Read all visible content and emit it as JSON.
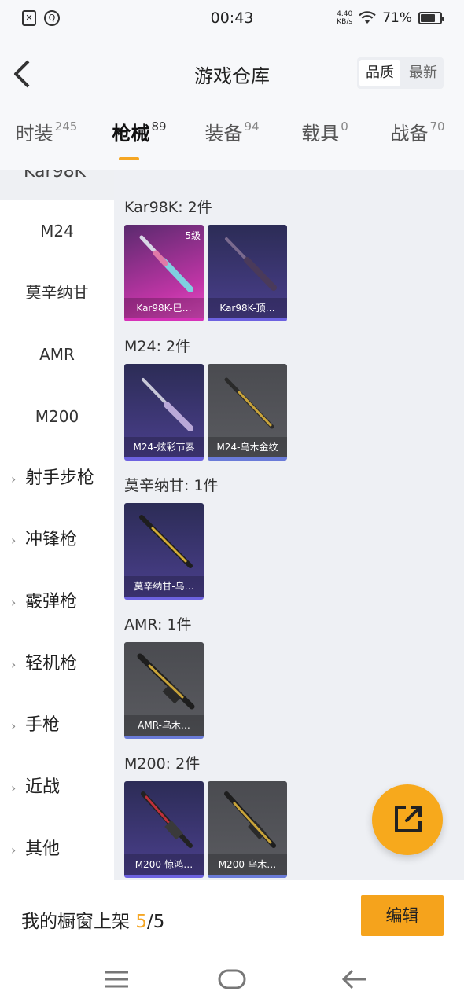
{
  "status_bar": {
    "time": "00:43",
    "net_speed_value": "4.40",
    "net_speed_unit": "KB/s",
    "battery_percent": "71%",
    "battery_level": 0.71
  },
  "header": {
    "title": "游戏仓库",
    "sort_options": [
      "品质",
      "最新"
    ],
    "sort_selected": "品质"
  },
  "tabs": [
    {
      "label": "时装",
      "count": "245"
    },
    {
      "label": "枪械",
      "count": "89",
      "active": true
    },
    {
      "label": "装备",
      "count": "94"
    },
    {
      "label": "载具",
      "count": "0"
    },
    {
      "label": "战备",
      "count": "70"
    }
  ],
  "sidebar": {
    "partial_top": "Kar98K",
    "items": [
      "M24",
      "莫辛纳甘",
      "AMR",
      "M200"
    ],
    "groups": [
      "射手步枪",
      "冲锋枪",
      "霰弹枪",
      "轻机枪",
      "手枪",
      "近战",
      "其他"
    ]
  },
  "sections": [
    {
      "title": "Kar98K: 2件",
      "cards": [
        {
          "name": "Kar98K-巳…",
          "level": "5级",
          "style": "pink"
        },
        {
          "name": "Kar98K-顶…",
          "style": "purple"
        }
      ]
    },
    {
      "title": "M24: 2件",
      "cards": [
        {
          "name": "M24-炫彩节奏",
          "style": "purple"
        },
        {
          "name": "M24-乌木金纹",
          "style": "gray"
        }
      ]
    },
    {
      "title": "莫辛纳甘: 1件",
      "cards": [
        {
          "name": "莫辛纳甘-乌…",
          "style": "purple"
        }
      ]
    },
    {
      "title": "AMR: 1件",
      "cards": [
        {
          "name": "AMR-乌木…",
          "style": "gray"
        }
      ]
    },
    {
      "title": "M200: 2件",
      "cards": [
        {
          "name": "M200-惊鸿…",
          "style": "purple"
        },
        {
          "name": "M200-乌木…",
          "style": "gray"
        }
      ]
    }
  ],
  "bottom": {
    "showcase_label": "我的橱窗上架",
    "showcase_current": "5",
    "showcase_sep": "/",
    "showcase_total": "5",
    "edit_label": "编辑"
  },
  "colors": {
    "accent": "#f5a623",
    "card_pink": "#d632b8",
    "card_purple": "#4a3f8c",
    "card_gray": "#55565b"
  }
}
